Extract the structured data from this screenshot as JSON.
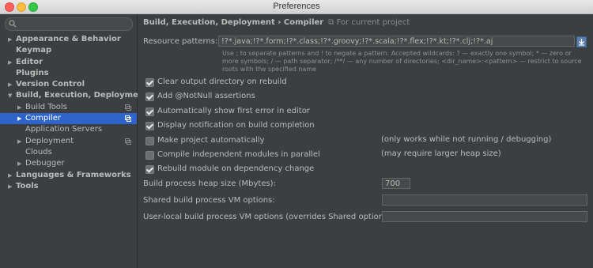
{
  "window": {
    "title": "Preferences"
  },
  "search": {
    "placeholder": "",
    "value": ""
  },
  "sidebar": {
    "items": [
      {
        "label": "Appearance & Behavior",
        "arrow": "▶",
        "bold": true
      },
      {
        "label": "Keymap",
        "arrow": "",
        "bold": true
      },
      {
        "label": "Editor",
        "arrow": "▶",
        "bold": true
      },
      {
        "label": "Plugins",
        "arrow": "",
        "bold": true
      },
      {
        "label": "Version Control",
        "arrow": "▶",
        "bold": true
      },
      {
        "label": "Build, Execution, Deployment",
        "arrow": "▼",
        "bold": true
      },
      {
        "label": "Build Tools",
        "arrow": "▶",
        "bold": false,
        "copy": true
      },
      {
        "label": "Compiler",
        "arrow": "▶",
        "bold": false,
        "copy": true,
        "selected": true
      },
      {
        "label": "Application Servers",
        "arrow": "",
        "bold": false
      },
      {
        "label": "Deployment",
        "arrow": "▶",
        "bold": false,
        "copy": true
      },
      {
        "label": "Clouds",
        "arrow": "",
        "bold": false
      },
      {
        "label": "Debugger",
        "arrow": "▶",
        "bold": false
      },
      {
        "label": "Languages & Frameworks",
        "arrow": "▶",
        "bold": true
      },
      {
        "label": "Tools",
        "arrow": "▶",
        "bold": true
      }
    ]
  },
  "main": {
    "breadcrumb": "Build, Execution, Deployment › Compiler",
    "scope": "For current project",
    "resource_patterns": {
      "label": "Resource patterns:",
      "value": "!?*.java;!?*.form;!?*.class;!?*.groovy;!?*.scala;!?*.flex;!?*.kt;!?*.clj;!?*.aj"
    },
    "hint": "Use ; to separate patterns and ! to negate a pattern. Accepted wildcards: ? — exactly one symbol; * — zero or more symbols; / — path separator; /**/ — any number of directories; <dir_name>:<pattern> — restrict to source roots with the specified name",
    "options": [
      {
        "label": "Clear output directory on rebuild",
        "checked": true,
        "note": ""
      },
      {
        "label": "Add @NotNull assertions",
        "checked": true,
        "note": ""
      },
      {
        "label": "Automatically show first error in editor",
        "checked": true,
        "note": ""
      },
      {
        "label": "Display notification on build completion",
        "checked": true,
        "note": ""
      },
      {
        "label": "Make project automatically",
        "checked": false,
        "note": "(only works while not running / debugging)"
      },
      {
        "label": "Compile independent modules in parallel",
        "checked": false,
        "note": "(may require larger heap size)"
      },
      {
        "label": "Rebuild module on dependency change",
        "checked": true,
        "note": ""
      }
    ],
    "heap": {
      "label": "Build process heap size (Mbytes):",
      "value": "700"
    },
    "shared_vm": {
      "label": "Shared build process VM options:",
      "value": ""
    },
    "user_vm": {
      "label": "User-local build process VM options (overrides Shared options):",
      "value": ""
    }
  },
  "colors": {
    "selection": "#2f65ca",
    "background": "#3c3f41",
    "text": "#bbbbbb"
  }
}
